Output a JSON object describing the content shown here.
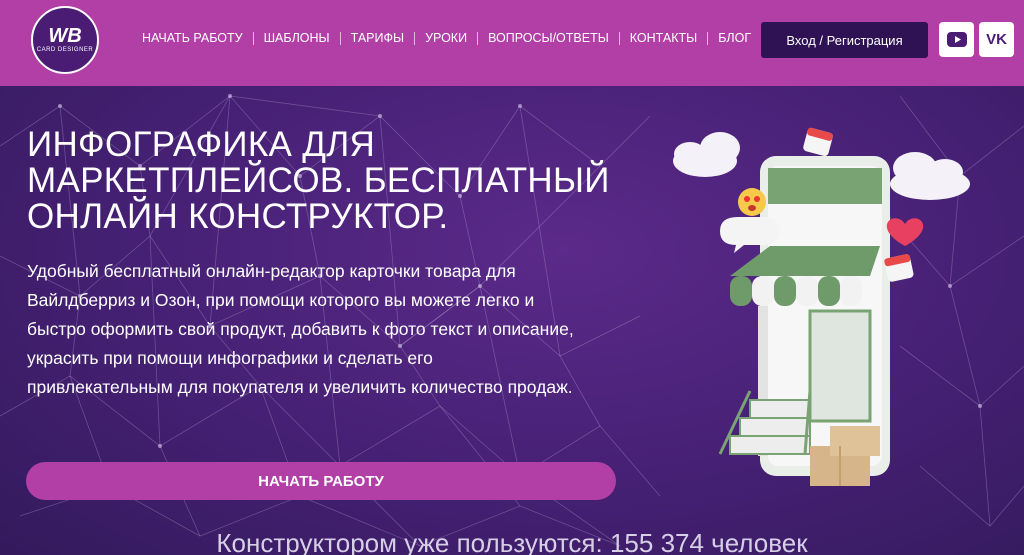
{
  "logo": {
    "main": "WB",
    "sub": "CARD DESIGNER"
  },
  "nav": [
    "НАЧАТЬ РАБОТУ",
    "ШАБЛОНЫ",
    "ТАРИФЫ",
    "УРОКИ",
    "ВОПРОСЫ/ОТВЕТЫ",
    "КОНТАКТЫ",
    "БЛОГ"
  ],
  "header": {
    "login_label": "Вход / Регистрация"
  },
  "social": {
    "youtube_icon": "youtube-icon",
    "vk_icon": "vk-icon",
    "vk_label": "VK"
  },
  "hero": {
    "title_line1": "ИНФОГРАФИКА ДЛЯ",
    "title_line2": "МАРКЕТПЛЕЙСОВ. БЕСПЛАТНЫЙ",
    "title_line3": "ОНЛАЙН КОНСТРУКТОР.",
    "text_line1": "Удобный бесплатный онлайн-редактор карточки товара для",
    "text_line2": "Вайлдберриз и Озон, при помощи которого вы можете легко и",
    "text_line3": "быстро оформить свой продукт, добавить к фото текст и описание,",
    "text_line4": "украсить при помощи инфографики и  сделать его",
    "text_line5": "привлекательным для покупателя и увеличить  количество продаж.",
    "cta_label": "НАЧАТЬ РАБОТУ",
    "counter": "Конструктором уже пользуются: 155 374 человек"
  },
  "colors": {
    "header_bg": "#b13fa6",
    "hero_bg": "#452073",
    "login_bg": "#2f1254",
    "cta_bg": "#b13fa6",
    "awning_green": "#6f9a6a"
  }
}
